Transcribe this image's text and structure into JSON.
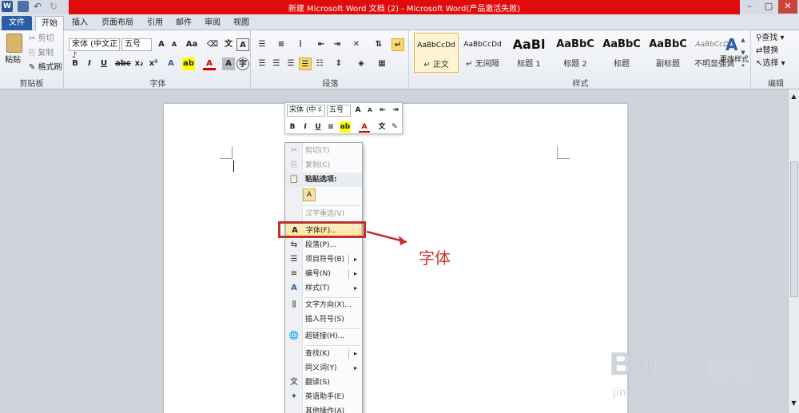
{
  "window": {
    "title": "新建 Microsoft Word 文档 (2) - Microsoft Word(产品激活失败)",
    "controls": [
      "–",
      "□",
      "✕"
    ]
  },
  "tabs": {
    "file": "文件",
    "items": [
      "开始",
      "插入",
      "页面布局",
      "引用",
      "邮件",
      "审阅",
      "视图"
    ]
  },
  "clipboard": {
    "paste": "粘贴",
    "cut": "剪切",
    "copy": "复制",
    "format_painter": "格式刷",
    "group_label": "剪贴板"
  },
  "font": {
    "font_name": "宋体 (中文正♪",
    "font_size": "五号",
    "group_label": "字体"
  },
  "paragraph": {
    "group_label": "段落"
  },
  "styles": {
    "items": [
      {
        "preview": "AaBbCcDd",
        "name": "↵ 正文"
      },
      {
        "preview": "AaBbCcDd",
        "name": "↵ 无间隔"
      },
      {
        "preview": "AaBl",
        "name": "标题 1"
      },
      {
        "preview": "AaBbC",
        "name": "标题 2"
      },
      {
        "preview": "AaBbC",
        "name": "标题"
      },
      {
        "preview": "AaBbC",
        "name": "副标题"
      },
      {
        "preview": "AaBbCcDd",
        "name": "不明显强调"
      }
    ],
    "change_styles": "更改样式",
    "group_label": "样式"
  },
  "editing": {
    "find": "查找 ▾",
    "replace": "替换",
    "select": "选择 ▾",
    "group_label": "编辑"
  },
  "mini_toolbar": {
    "font_name": "宋体 (中ゞ",
    "font_size": "五号"
  },
  "context_menu": {
    "cut": "剪切(T)",
    "copy": "复制(C)",
    "paste_options": "粘贴选项:",
    "reconvert": "汉字重选(V)",
    "font": "字体(F)...",
    "paragraph": "段落(P)...",
    "bullets": "项目符号(B)",
    "numbering": "编号(N)",
    "styles": "样式(T)",
    "text_direction": "文字方向(X)...",
    "insert_symbol": "插入符号(S)",
    "hyperlink": "超链接(H)...",
    "lookup": "查找(K)",
    "synonyms": "同义词(Y)",
    "translate": "翻译(S)",
    "english_assistant": "英语助手(E)",
    "more": "其他操作(A)"
  },
  "annotation": {
    "callout": "字体"
  },
  "watermark": {
    "brand": "Bai",
    "brand2": "经验",
    "url": "jingyan.baidu.com"
  },
  "colors": {
    "title_red": "#e10b0b",
    "file_tab": "#2a5ea8",
    "highlight_box": "#c2302c"
  }
}
